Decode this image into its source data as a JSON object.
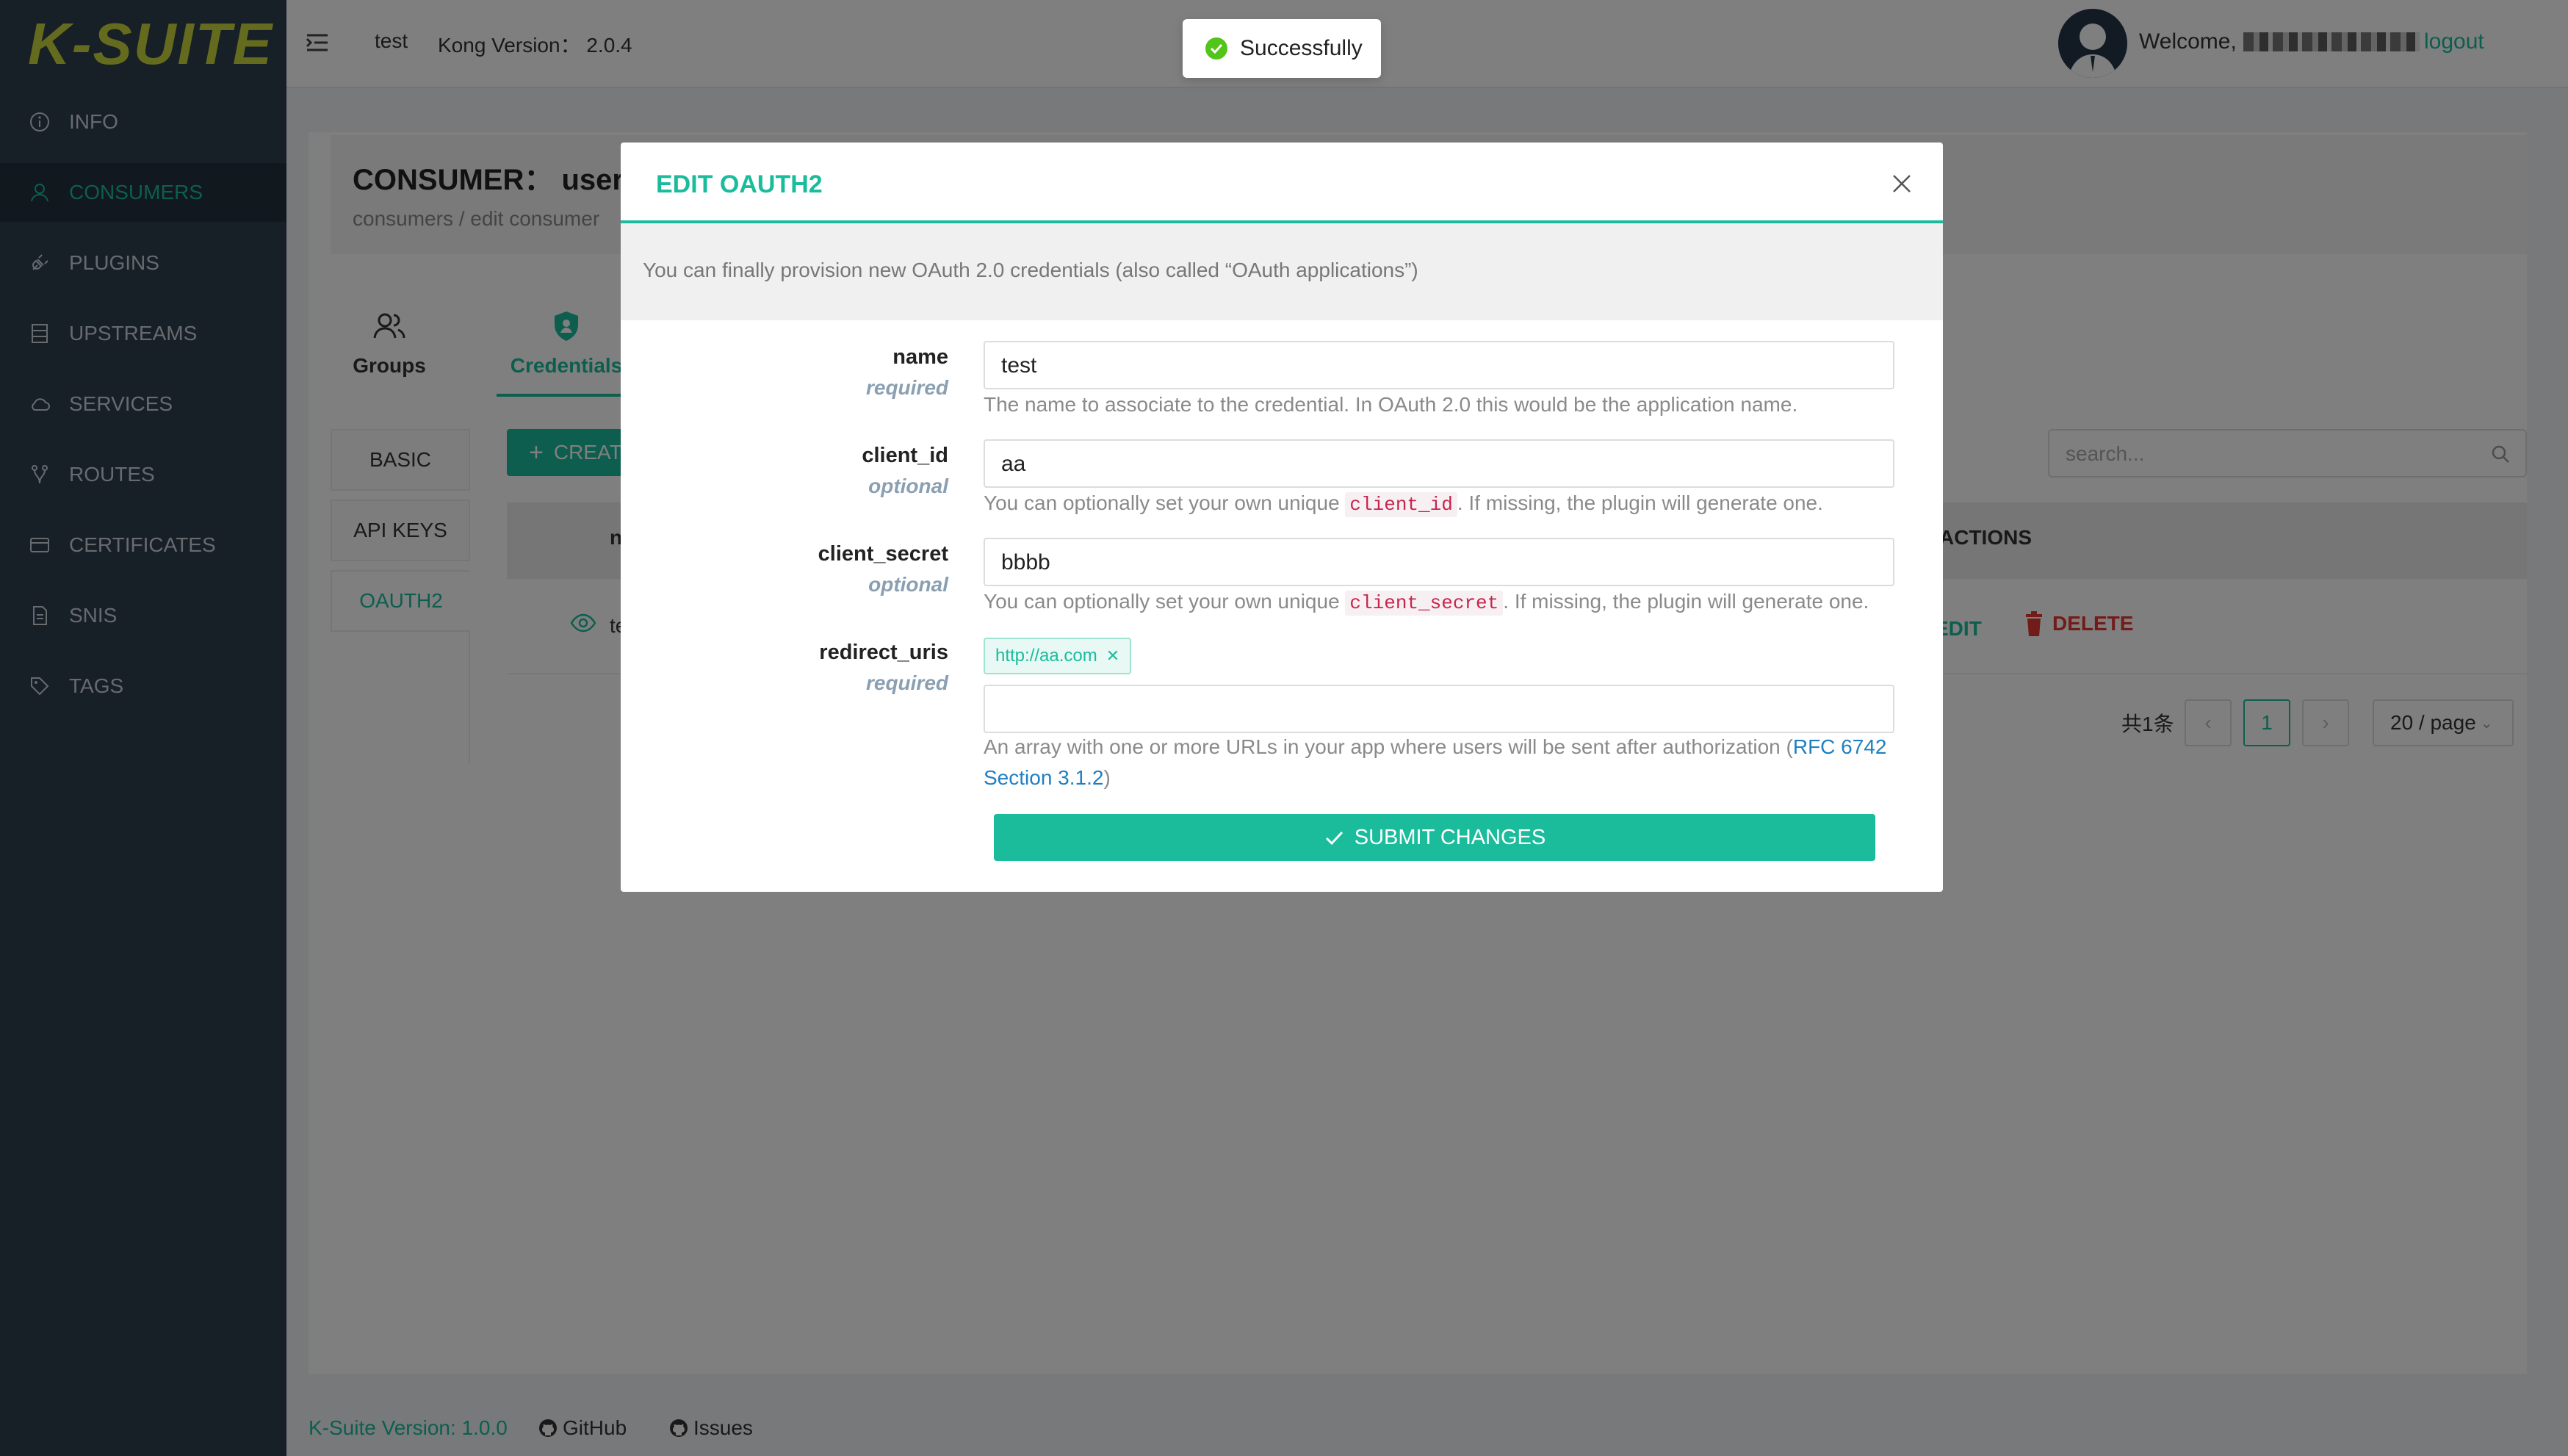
{
  "app": {
    "logo": "K-SUITE",
    "brand_color": "#1abc9c"
  },
  "sidebar": {
    "items": [
      {
        "label": "INFO",
        "icon": "info-icon"
      },
      {
        "label": "CONSUMERS",
        "icon": "user-icon",
        "active": true
      },
      {
        "label": "PLUGINS",
        "icon": "plug-icon"
      },
      {
        "label": "UPSTREAMS",
        "icon": "server-icon"
      },
      {
        "label": "SERVICES",
        "icon": "cloud-icon"
      },
      {
        "label": "ROUTES",
        "icon": "route-icon"
      },
      {
        "label": "CERTIFICATES",
        "icon": "certificate-icon"
      },
      {
        "label": "SNIS",
        "icon": "document-icon"
      },
      {
        "label": "TAGS",
        "icon": "tag-icon"
      }
    ]
  },
  "header": {
    "env_name": "test",
    "kong_version": "Kong Version： 2.0.4",
    "welcome": "Welcome,",
    "logout": "logout"
  },
  "page": {
    "title": "CONSUMER： user",
    "breadcrumb": "consumers / edit consumer",
    "tabs": [
      "Groups",
      "Credentials"
    ],
    "side_tabs": [
      "BASIC",
      "API KEYS",
      "OAUTH2"
    ],
    "create_label": "CREATE",
    "search_placeholder": "search...",
    "table": {
      "col_name": "name",
      "col_actions": "ACTIONS",
      "row_text": "test",
      "edit_label": "EDIT",
      "delete_label": "DELETE"
    },
    "pagination": {
      "total": "共1条",
      "current": "1",
      "page_size": "20 / page"
    }
  },
  "footer": {
    "version": "K-Suite Version: 1.0.0",
    "github": "GitHub",
    "issues": "Issues"
  },
  "toast": {
    "message": "Successfully"
  },
  "modal": {
    "title": "EDIT OAUTH2",
    "info": "You can finally provision new OAuth 2.0 credentials (also called “OAuth applications”)",
    "fields": {
      "name": {
        "label": "name",
        "req": "required",
        "value": "test",
        "help": "The name to associate to the credential. In OAuth 2.0 this would be the application name."
      },
      "client_id": {
        "label": "client_id",
        "req": "optional",
        "value": "aa",
        "help_pre": "You can optionally set your own unique",
        "help_code": "client_id",
        "help_post": ". If missing, the plugin will generate one."
      },
      "client_secret": {
        "label": "client_secret",
        "req": "optional",
        "value": "bbbb",
        "help_pre": "You can optionally set your own unique",
        "help_code": "client_secret",
        "help_post": ". If missing, the plugin will generate one."
      },
      "redirect_uris": {
        "label": "redirect_uris",
        "req": "required",
        "tag": "http://aa.com",
        "value": "",
        "help_pre": "An array with one or more URLs in your app where users will be sent after authorization (",
        "help_link": "RFC 6742 Section 3.1.2",
        "help_post": ")"
      }
    },
    "submit_label": "SUBMIT CHANGES"
  }
}
